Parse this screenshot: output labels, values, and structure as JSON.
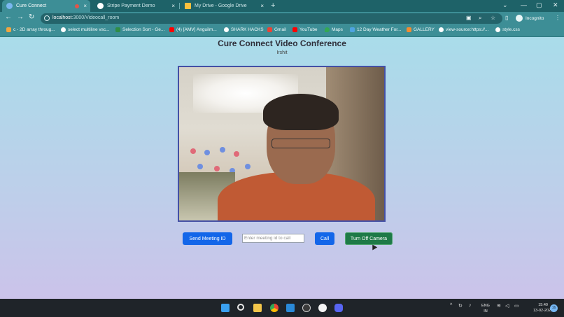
{
  "browser": {
    "tabs": [
      {
        "title": "Cure Connect",
        "active": true,
        "close": "×"
      },
      {
        "title": "Stripe Payment Demo",
        "active": false,
        "close": "×"
      },
      {
        "title": "My Drive - Google Drive",
        "active": false,
        "close": "×"
      }
    ],
    "new_tab": "+",
    "window_controls": {
      "dropdown": "⌄",
      "minimize": "—",
      "maximize": "▢",
      "close": "✕"
    },
    "nav": {
      "back": "←",
      "forward": "→",
      "reload": "↻"
    },
    "url_host": "localhost",
    "url_path": ":3000/Videocall_room",
    "incognito_label": "Incognito",
    "menu": "⋮",
    "bookmarks": [
      {
        "label": "c - 2D array throug...",
        "color": "#f0a640"
      },
      {
        "label": "select multiline vsc...",
        "color": "#ffffff"
      },
      {
        "label": "Selection Sort - Ge...",
        "color": "#2f8d46"
      },
      {
        "label": "(4) [AMV] Anguilm...",
        "color": "#ff0000"
      },
      {
        "label": "SHARK HACKS",
        "color": "#ffffff"
      },
      {
        "label": "Gmail",
        "color": "#ea4335"
      },
      {
        "label": "YouTube",
        "color": "#ff0000"
      },
      {
        "label": "Maps",
        "color": "#34a853"
      },
      {
        "label": "12 Day Weather For...",
        "color": "#4fa3e0"
      },
      {
        "label": "GALLERY",
        "color": "#f28b30"
      },
      {
        "label": "view-source:https://...",
        "color": "#ffffff"
      },
      {
        "label": "style.css",
        "color": "#ffffff"
      }
    ]
  },
  "page": {
    "title": "Cure Connect Video Conference",
    "username": "Irshit",
    "send_meeting_label": "Send Meeting ID",
    "meeting_placeholder": "Enter meeting id to call",
    "call_label": "Call",
    "camera_toggle_label": "Turn Off Camera"
  },
  "taskbar": {
    "apps": [
      "windows-start",
      "search",
      "file-explorer",
      "chrome",
      "vscode",
      "obs",
      "whatsapp",
      "discord"
    ],
    "tray_chevron": "^",
    "language_line1": "ENG",
    "language_line2": "IN",
    "time": "15:40",
    "date": "13-02-2022",
    "notification_count": "16"
  },
  "colors": {
    "tabstrip": "#1e6268",
    "toolbar": "#3d8e96",
    "button_blue": "#1366e9",
    "button_green": "#1e7a47",
    "video_border": "#4450a5",
    "taskbar": "#1f2429"
  }
}
